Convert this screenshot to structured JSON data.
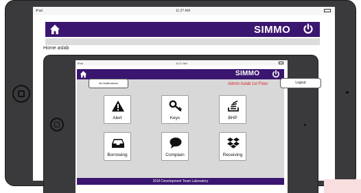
{
  "back_screen": {
    "status": {
      "carrier": "iPad",
      "time": "11:27 AM"
    },
    "header": {
      "title": "SIMMO"
    },
    "breadcrumb": "Home aslab"
  },
  "front_screen": {
    "status": {
      "carrier": "iPad",
      "time": "11:27 AM"
    },
    "header": {
      "title": "SIMMO"
    },
    "notification_label": "No Notifications",
    "admin_text": "Admin Aslab 1st Floor",
    "logout_label": "Logout",
    "tiles": [
      {
        "label": "Alert",
        "icon": "warning-icon"
      },
      {
        "label": "Keys",
        "icon": "key-icon"
      },
      {
        "label": "BHP",
        "icon": "stack-icon"
      },
      {
        "label": "Borrowing",
        "icon": "inbox-icon"
      },
      {
        "label": "Complain",
        "icon": "chat-bubble-icon"
      },
      {
        "label": "Receiving",
        "icon": "dropbox-icon"
      }
    ],
    "footer": "2018 Development Team Laboratory"
  },
  "colors": {
    "nav_bar": "#3b1670",
    "admin_text": "#e0202a",
    "panel_bg": "#d8d8d8",
    "bezel": "#3a3a3c"
  }
}
